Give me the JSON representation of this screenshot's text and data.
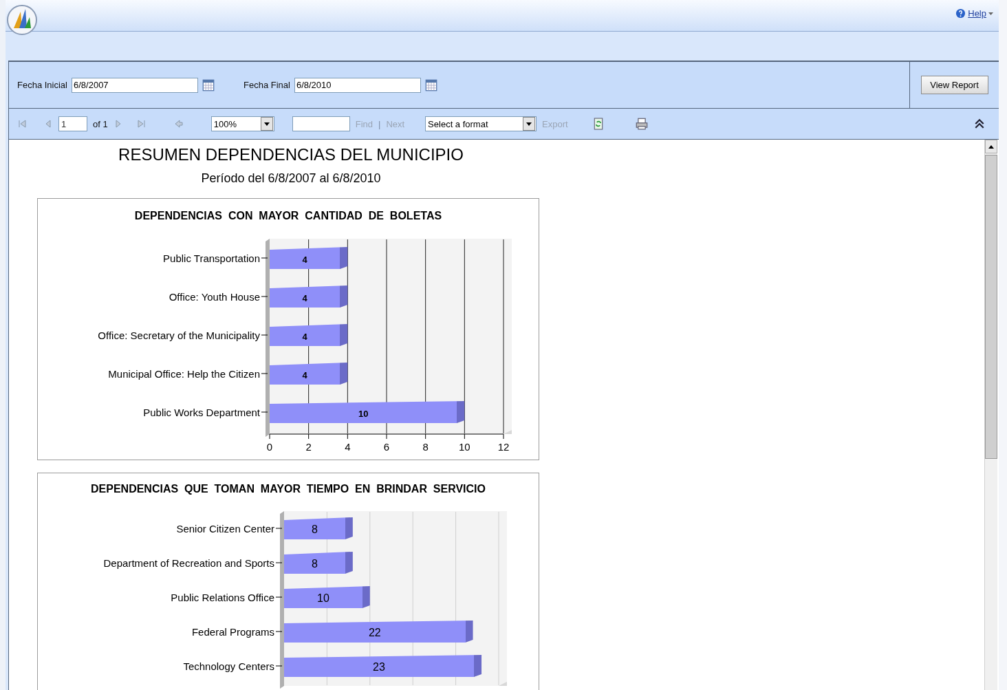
{
  "header": {
    "help_link": "Help"
  },
  "parameters": [
    {
      "label": "Fecha Inicial",
      "value": "6/8/2007"
    },
    {
      "label": "Fecha Final",
      "value": "6/8/2010"
    }
  ],
  "view_report_button": "View Report",
  "toolbar": {
    "page_value": "1",
    "page_total": "of 1",
    "zoom": "100%",
    "find_link": {
      "label": "Find",
      "disabled": true
    },
    "separator": "|",
    "next_link": {
      "label": "Next",
      "disabled": true
    },
    "format_select": "Select a format",
    "export_link": {
      "label": "Export",
      "disabled": true
    }
  },
  "report": {
    "title": "RESUMEN DEPENDENCIAS DEL MUNICIPIO",
    "subtitle": "Período del 6/8/2007 al 6/8/2010",
    "charts": [
      {
        "chart_data": {
          "type": "bar",
          "orientation": "horizontal",
          "title": "DEPENDENCIAS  CON  MAYOR  CANTIDAD  DE  BOLETAS",
          "categories": [
            "Public Transportation",
            "Office: Youth House",
            "Office: Secretary of the Municipality",
            "Municipal Office: Help the Citizen",
            "Public Works Department"
          ],
          "series": [
            {
              "color": "#8f8ff9",
              "values": [
                4,
                4,
                4,
                4,
                10
              ]
            }
          ],
          "xlim": [
            0,
            12
          ],
          "xticks": [
            0,
            2,
            4,
            6,
            8,
            10,
            12
          ],
          "grid": true,
          "data_labels": true
        }
      },
      {
        "chart_data": {
          "type": "bar",
          "orientation": "horizontal",
          "title": "DEPENDENCIAS  QUE  TOMAN  MAYOR  TIEMPO  EN  BRINDAR  SERVICIO",
          "categories": [
            "Senior Citizen Center",
            "Department of Recreation and Sports",
            "Public Relations Office",
            "Federal Programs",
            "Technology Centers"
          ],
          "series": [
            {
              "color": "#8f8ff9",
              "values": [
                8,
                8,
                10,
                22,
                23
              ]
            }
          ],
          "grid": true,
          "data_labels": true
        }
      }
    ]
  }
}
